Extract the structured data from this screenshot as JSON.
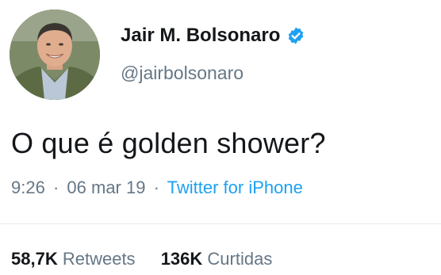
{
  "tweet": {
    "author": {
      "display_name": "Jair M. Bolsonaro",
      "handle": "@jairbolsonaro",
      "verified": true,
      "avatar_icon": "profile-photo"
    },
    "text": "O que é golden shower?",
    "meta": {
      "time": "9:26",
      "separator": "·",
      "date": "06 mar 19",
      "source": "Twitter for iPhone"
    },
    "stats": {
      "retweets_count": "58,7K",
      "retweets_label": "Retweets",
      "likes_count": "136K",
      "likes_label": "Curtidas"
    }
  },
  "colors": {
    "primary_text": "#14171a",
    "secondary_text": "#657786",
    "link": "#1da1f2",
    "verified_badge": "#1da1f2"
  }
}
